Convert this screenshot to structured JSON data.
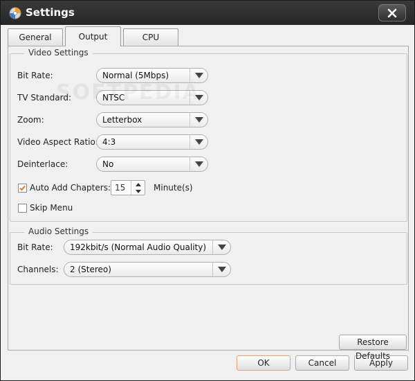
{
  "window": {
    "title": "Settings"
  },
  "tabs": [
    {
      "label": "General"
    },
    {
      "label": "Output",
      "active": true
    },
    {
      "label": "CPU"
    }
  ],
  "video_settings": {
    "title": "Video Settings",
    "bit_rate": {
      "label": "Bit Rate:",
      "value": "Normal (5Mbps)"
    },
    "tv_standard": {
      "label": "TV Standard:",
      "value": "NTSC"
    },
    "zoom": {
      "label": "Zoom:",
      "value": "Letterbox"
    },
    "aspect_ratio": {
      "label": "Video Aspect Ratio:",
      "value": "4:3"
    },
    "deinterlace": {
      "label": "Deinterlace:",
      "value": "No"
    },
    "auto_add_chapters": {
      "label": "Auto Add Chapters:",
      "checked": true,
      "value": "15",
      "unit": "Minute(s)"
    },
    "skip_menu": {
      "label": "Skip Menu",
      "checked": false
    }
  },
  "audio_settings": {
    "title": "Audio Settings",
    "bit_rate": {
      "label": "Bit Rate:",
      "value": "192kbit/s (Normal Audio Quality)"
    },
    "channels": {
      "label": "Channels:",
      "value": "2 (Stereo)"
    }
  },
  "buttons": {
    "restore_defaults": "Restore Defaults",
    "ok": "OK",
    "cancel": "Cancel",
    "apply": "Apply"
  },
  "watermark": "SOFTPEDIA",
  "colors": {
    "titlebar": "#2e2e2e",
    "check_accent": "#e07820",
    "ok_border": "#e8a070"
  }
}
